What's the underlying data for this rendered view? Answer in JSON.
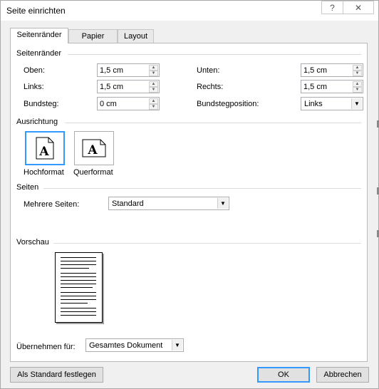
{
  "window": {
    "title": "Seite einrichten",
    "help_label": "?",
    "close_label": "✕"
  },
  "tabs": [
    {
      "label": "Seitenränder",
      "active": true
    },
    {
      "label": "Papier",
      "active": false
    },
    {
      "label": "Layout",
      "active": false
    }
  ],
  "margins": {
    "section_title": "Seitenränder",
    "top_label": "Oben:",
    "top_value": "1,5 cm",
    "bottom_label": "Unten:",
    "bottom_value": "1,5 cm",
    "left_label": "Links:",
    "left_value": "1,5 cm",
    "right_label": "Rechts:",
    "right_value": "1,5 cm",
    "gutter_label": "Bundsteg:",
    "gutter_value": "0 cm",
    "gutter_pos_label": "Bundstegposition:",
    "gutter_pos_value": "Links"
  },
  "orientation": {
    "section_title": "Ausrichtung",
    "portrait_label": "Hochformat",
    "landscape_label": "Querformat",
    "icon_letter": "A",
    "selected": "portrait"
  },
  "pages": {
    "section_title": "Seiten",
    "multiple_label": "Mehrere Seiten:",
    "multiple_value": "Standard"
  },
  "preview": {
    "section_title": "Vorschau"
  },
  "apply": {
    "label": "Übernehmen für:",
    "value": "Gesamtes Dokument"
  },
  "buttons": {
    "default_label": "Als Standard festlegen",
    "ok_label": "OK",
    "cancel_label": "Abbrechen"
  },
  "colors": {
    "accent": "#3399ff"
  }
}
